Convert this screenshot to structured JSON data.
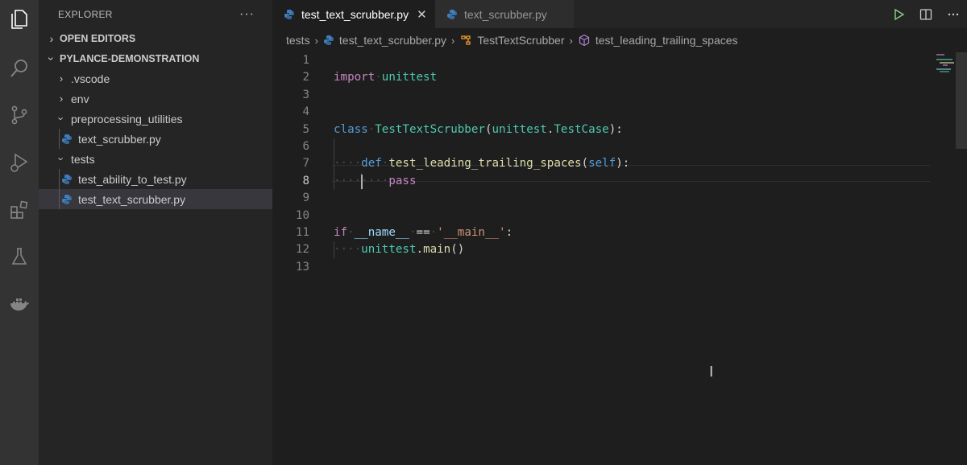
{
  "activity_bar": {
    "items": [
      {
        "icon": "files-icon"
      },
      {
        "icon": "search-icon"
      },
      {
        "icon": "source-control-icon"
      },
      {
        "icon": "run-debug-icon"
      },
      {
        "icon": "extensions-icon"
      },
      {
        "icon": "testing-flask-icon"
      },
      {
        "icon": "docker-icon"
      }
    ]
  },
  "sidebar": {
    "title": "EXPLORER",
    "more": "···",
    "open_editors": "OPEN EDITORS",
    "project": "PYLANCE-DEMONSTRATION",
    "tree": [
      {
        "label": ".vscode",
        "type": "folder",
        "expanded": false
      },
      {
        "label": "env",
        "type": "folder",
        "expanded": false
      },
      {
        "label": "preprocessing_utilities",
        "type": "folder",
        "expanded": true
      },
      {
        "label": "text_scrubber.py",
        "type": "file"
      },
      {
        "label": "tests",
        "type": "folder",
        "expanded": true
      },
      {
        "label": "test_ability_to_test.py",
        "type": "file"
      },
      {
        "label": "test_text_scrubber.py",
        "type": "file",
        "selected": true
      }
    ]
  },
  "tabs": [
    {
      "label": "test_text_scrubber.py",
      "active": true,
      "close": "✕"
    },
    {
      "label": "text_scrubber.py",
      "active": false
    }
  ],
  "breadcrumb": {
    "parts": [
      "tests",
      "test_text_scrubber.py",
      "TestTextScrubber",
      "test_leading_trailing_spaces"
    ]
  },
  "editor": {
    "line_numbers": [
      "1",
      "2",
      "3",
      "4",
      "5",
      "6",
      "7",
      "8",
      "9",
      "10",
      "11",
      "12",
      "13"
    ],
    "current_line": 8,
    "code": {
      "l2_kw": "import",
      "l2_mod": "unittest",
      "l5_kw": "class",
      "l5_cls": "TestTextScrubber",
      "l5_base_mod": "unittest",
      "l5_base_cls": "TestCase",
      "l7_kw": "def",
      "l7_fn": "test_leading_trailing_spaces",
      "l7_param": "self",
      "l8_kw": "pass",
      "l11_kw": "if",
      "l11_var": "__name__",
      "l11_op": "==",
      "l11_str": "'__main__'",
      "l12_mod": "unittest",
      "l12_fn": "main"
    }
  },
  "colors": {
    "keyword": "#c586c0",
    "storage": "#569cd6",
    "class": "#4ec9b0",
    "function": "#dcdcaa",
    "variable": "#9cdcfe",
    "string": "#ce9178",
    "python_blue": "#3f7fbf",
    "python_yellow": "#f2c94c"
  }
}
